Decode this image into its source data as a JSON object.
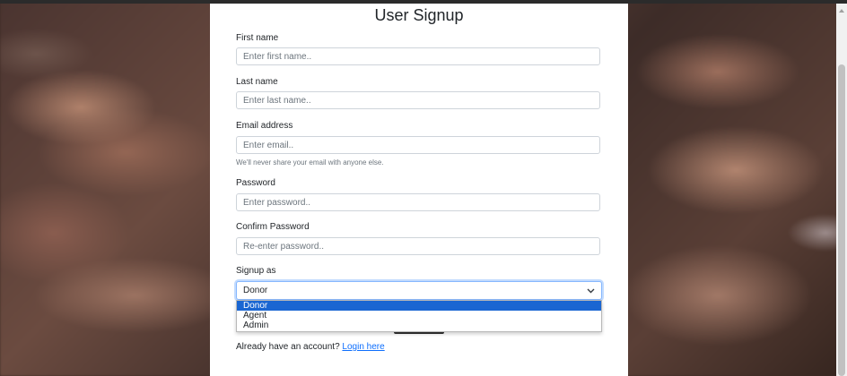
{
  "form": {
    "title": "User Signup",
    "first_name": {
      "label": "First name",
      "placeholder": "Enter first name.."
    },
    "last_name": {
      "label": "Last name",
      "placeholder": "Enter last name.."
    },
    "email": {
      "label": "Email address",
      "placeholder": "Enter email..",
      "help": "We'll never share your email with anyone else."
    },
    "password": {
      "label": "Password",
      "placeholder": "Enter password.."
    },
    "confirm_password": {
      "label": "Confirm Password",
      "placeholder": "Re-enter password.."
    },
    "signup_as": {
      "label": "Signup as",
      "selected": "Donor",
      "options": [
        "Donor",
        "Agent",
        "Admin"
      ]
    },
    "account_prompt": "Already have an account?",
    "login_link": "Login here"
  },
  "colors": {
    "accent": "#0d6efd",
    "selected_option_bg": "#1a66d2",
    "focus_border": "#86b7fe"
  },
  "icons": {
    "select_caret": "chevron-down-icon"
  }
}
